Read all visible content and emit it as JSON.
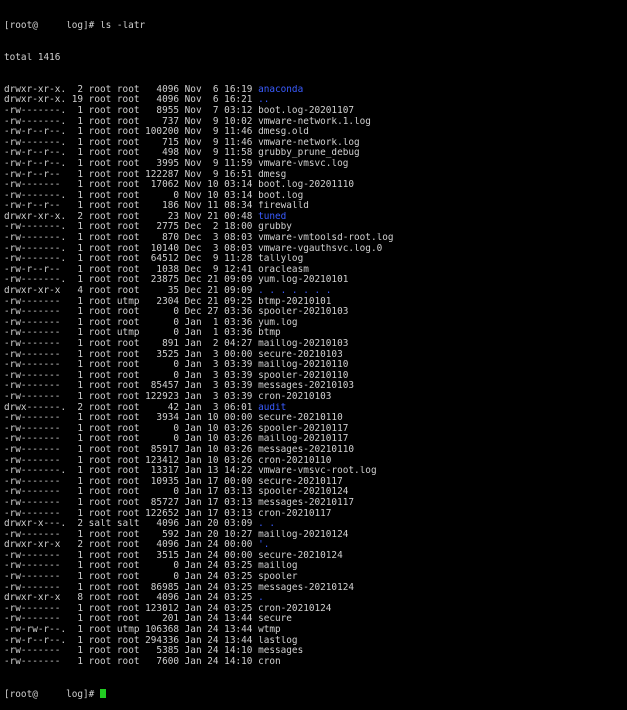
{
  "colors": {
    "background": "#000000",
    "text": "#d0d0d0",
    "directory": "#3a5cff",
    "cursor": "#22cc22"
  },
  "prompt": "[root@     log]# ls -latr",
  "total": "total 1416",
  "entries": [
    {
      "perm": "drwxr-xr-x.",
      "links": "2",
      "owner": "root",
      "group": "root",
      "size": "4096",
      "month": "Nov",
      "day": "6",
      "time": "16:19",
      "name": "anaconda",
      "is_dir": true
    },
    {
      "perm": "drwxr-xr-x.",
      "links": "19",
      "owner": "root",
      "group": "root",
      "size": "4096",
      "month": "Nov",
      "day": "6",
      "time": "16:21",
      "name": "..",
      "is_dir": true
    },
    {
      "perm": "-rw-------.",
      "links": "1",
      "owner": "root",
      "group": "root",
      "size": "8955",
      "month": "Nov",
      "day": "7",
      "time": "03:12",
      "name": "boot.log-20201107",
      "is_dir": false
    },
    {
      "perm": "-rw-------.",
      "links": "1",
      "owner": "root",
      "group": "root",
      "size": "737",
      "month": "Nov",
      "day": "9",
      "time": "10:02",
      "name": "vmware-network.1.log",
      "is_dir": false
    },
    {
      "perm": "-rw-r--r--.",
      "links": "1",
      "owner": "root",
      "group": "root",
      "size": "100200",
      "month": "Nov",
      "day": "9",
      "time": "11:46",
      "name": "dmesg.old",
      "is_dir": false
    },
    {
      "perm": "-rw-------.",
      "links": "1",
      "owner": "root",
      "group": "root",
      "size": "715",
      "month": "Nov",
      "day": "9",
      "time": "11:46",
      "name": "vmware-network.log",
      "is_dir": false
    },
    {
      "perm": "-rw-r--r--.",
      "links": "1",
      "owner": "root",
      "group": "root",
      "size": "498",
      "month": "Nov",
      "day": "9",
      "time": "11:58",
      "name": "grubby_prune_debug",
      "is_dir": false
    },
    {
      "perm": "-rw-r--r--.",
      "links": "1",
      "owner": "root",
      "group": "root",
      "size": "3995",
      "month": "Nov",
      "day": "9",
      "time": "11:59",
      "name": "vmware-vmsvc.log",
      "is_dir": false
    },
    {
      "perm": "-rw-r--r--",
      "links": "1",
      "owner": "root",
      "group": "root",
      "size": "122287",
      "month": "Nov",
      "day": "9",
      "time": "16:51",
      "name": "dmesg",
      "is_dir": false
    },
    {
      "perm": "-rw-------",
      "links": "1",
      "owner": "root",
      "group": "root",
      "size": "17062",
      "month": "Nov",
      "day": "10",
      "time": "03:14",
      "name": "boot.log-20201110",
      "is_dir": false
    },
    {
      "perm": "-rw-------.",
      "links": "1",
      "owner": "root",
      "group": "root",
      "size": "0",
      "month": "Nov",
      "day": "10",
      "time": "03:14",
      "name": "boot.log",
      "is_dir": false
    },
    {
      "perm": "-rw-r--r--",
      "links": "1",
      "owner": "root",
      "group": "root",
      "size": "186",
      "month": "Nov",
      "day": "11",
      "time": "08:34",
      "name": "firewalld",
      "is_dir": false
    },
    {
      "perm": "drwxr-xr-x.",
      "links": "2",
      "owner": "root",
      "group": "root",
      "size": "23",
      "month": "Nov",
      "day": "21",
      "time": "00:48",
      "name": "tuned",
      "is_dir": true
    },
    {
      "perm": "-rw-------.",
      "links": "1",
      "owner": "root",
      "group": "root",
      "size": "2775",
      "month": "Dec",
      "day": "2",
      "time": "18:00",
      "name": "grubby",
      "is_dir": false
    },
    {
      "perm": "-rw-------.",
      "links": "1",
      "owner": "root",
      "group": "root",
      "size": "870",
      "month": "Dec",
      "day": "3",
      "time": "08:03",
      "name": "vmware-vmtoolsd-root.log",
      "is_dir": false
    },
    {
      "perm": "-rw-------.",
      "links": "1",
      "owner": "root",
      "group": "root",
      "size": "10140",
      "month": "Dec",
      "day": "3",
      "time": "08:03",
      "name": "vmware-vgauthsvc.log.0",
      "is_dir": false
    },
    {
      "perm": "-rw-------.",
      "links": "1",
      "owner": "root",
      "group": "root",
      "size": "64512",
      "month": "Dec",
      "day": "9",
      "time": "11:28",
      "name": "tallylog",
      "is_dir": false
    },
    {
      "perm": "-rw-r--r--",
      "links": "1",
      "owner": "root",
      "group": "root",
      "size": "1038",
      "month": "Dec",
      "day": "9",
      "time": "12:41",
      "name": "oracleasm",
      "is_dir": false
    },
    {
      "perm": "-rw-------.",
      "links": "1",
      "owner": "root",
      "group": "root",
      "size": "23875",
      "month": "Dec",
      "day": "21",
      "time": "09:09",
      "name": "yum.log-20210101",
      "is_dir": false
    },
    {
      "perm": "drwxr-xr-x",
      "links": "4",
      "owner": "root",
      "group": "root",
      "size": "35",
      "month": "Dec",
      "day": "21",
      "time": "09:09",
      "name": ". . . . . . .",
      "is_dir": true
    },
    {
      "perm": "-rw-------",
      "links": "1",
      "owner": "root",
      "group": "utmp",
      "size": "2304",
      "month": "Dec",
      "day": "21",
      "time": "09:25",
      "name": "btmp-20210101",
      "is_dir": false
    },
    {
      "perm": "-rw-------",
      "links": "1",
      "owner": "root",
      "group": "root",
      "size": "0",
      "month": "Dec",
      "day": "27",
      "time": "03:36",
      "name": "spooler-20210103",
      "is_dir": false
    },
    {
      "perm": "-rw-------",
      "links": "1",
      "owner": "root",
      "group": "root",
      "size": "0",
      "month": "Jan",
      "day": "1",
      "time": "03:36",
      "name": "yum.log",
      "is_dir": false
    },
    {
      "perm": "-rw-------",
      "links": "1",
      "owner": "root",
      "group": "utmp",
      "size": "0",
      "month": "Jan",
      "day": "1",
      "time": "03:36",
      "name": "btmp",
      "is_dir": false
    },
    {
      "perm": "-rw-------",
      "links": "1",
      "owner": "root",
      "group": "root",
      "size": "891",
      "month": "Jan",
      "day": "2",
      "time": "04:27",
      "name": "maillog-20210103",
      "is_dir": false
    },
    {
      "perm": "-rw-------",
      "links": "1",
      "owner": "root",
      "group": "root",
      "size": "3525",
      "month": "Jan",
      "day": "3",
      "time": "00:00",
      "name": "secure-20210103",
      "is_dir": false
    },
    {
      "perm": "-rw-------",
      "links": "1",
      "owner": "root",
      "group": "root",
      "size": "0",
      "month": "Jan",
      "day": "3",
      "time": "03:39",
      "name": "maillog-20210110",
      "is_dir": false
    },
    {
      "perm": "-rw-------",
      "links": "1",
      "owner": "root",
      "group": "root",
      "size": "0",
      "month": "Jan",
      "day": "3",
      "time": "03:39",
      "name": "spooler-20210110",
      "is_dir": false
    },
    {
      "perm": "-rw-------",
      "links": "1",
      "owner": "root",
      "group": "root",
      "size": "85457",
      "month": "Jan",
      "day": "3",
      "time": "03:39",
      "name": "messages-20210103",
      "is_dir": false
    },
    {
      "perm": "-rw-------",
      "links": "1",
      "owner": "root",
      "group": "root",
      "size": "122923",
      "month": "Jan",
      "day": "3",
      "time": "03:39",
      "name": "cron-20210103",
      "is_dir": false
    },
    {
      "perm": "drwx------.",
      "links": "2",
      "owner": "root",
      "group": "root",
      "size": "42",
      "month": "Jan",
      "day": "3",
      "time": "06:01",
      "name": "audit",
      "is_dir": true
    },
    {
      "perm": "-rw-------",
      "links": "1",
      "owner": "root",
      "group": "root",
      "size": "3934",
      "month": "Jan",
      "day": "10",
      "time": "00:00",
      "name": "secure-20210110",
      "is_dir": false
    },
    {
      "perm": "-rw-------",
      "links": "1",
      "owner": "root",
      "group": "root",
      "size": "0",
      "month": "Jan",
      "day": "10",
      "time": "03:26",
      "name": "spooler-20210117",
      "is_dir": false
    },
    {
      "perm": "-rw-------",
      "links": "1",
      "owner": "root",
      "group": "root",
      "size": "0",
      "month": "Jan",
      "day": "10",
      "time": "03:26",
      "name": "maillog-20210117",
      "is_dir": false
    },
    {
      "perm": "-rw-------",
      "links": "1",
      "owner": "root",
      "group": "root",
      "size": "85917",
      "month": "Jan",
      "day": "10",
      "time": "03:26",
      "name": "messages-20210110",
      "is_dir": false
    },
    {
      "perm": "-rw-------",
      "links": "1",
      "owner": "root",
      "group": "root",
      "size": "123412",
      "month": "Jan",
      "day": "10",
      "time": "03:26",
      "name": "cron-20210110",
      "is_dir": false
    },
    {
      "perm": "-rw-------.",
      "links": "1",
      "owner": "root",
      "group": "root",
      "size": "13317",
      "month": "Jan",
      "day": "13",
      "time": "14:22",
      "name": "vmware-vmsvc-root.log",
      "is_dir": false
    },
    {
      "perm": "-rw-------",
      "links": "1",
      "owner": "root",
      "group": "root",
      "size": "10935",
      "month": "Jan",
      "day": "17",
      "time": "00:00",
      "name": "secure-20210117",
      "is_dir": false
    },
    {
      "perm": "-rw-------",
      "links": "1",
      "owner": "root",
      "group": "root",
      "size": "0",
      "month": "Jan",
      "day": "17",
      "time": "03:13",
      "name": "spooler-20210124",
      "is_dir": false
    },
    {
      "perm": "-rw-------",
      "links": "1",
      "owner": "root",
      "group": "root",
      "size": "85727",
      "month": "Jan",
      "day": "17",
      "time": "03:13",
      "name": "messages-20210117",
      "is_dir": false
    },
    {
      "perm": "-rw-------",
      "links": "1",
      "owner": "root",
      "group": "root",
      "size": "122652",
      "month": "Jan",
      "day": "17",
      "time": "03:13",
      "name": "cron-20210117",
      "is_dir": false
    },
    {
      "perm": "drwxr-x---.",
      "links": "2",
      "owner": "salt",
      "group": "salt",
      "size": "4096",
      "month": "Jan",
      "day": "20",
      "time": "03:09",
      "name": ". .",
      "is_dir": true
    },
    {
      "perm": "-rw-------",
      "links": "1",
      "owner": "root",
      "group": "root",
      "size": "592",
      "month": "Jan",
      "day": "20",
      "time": "10:27",
      "name": "maillog-20210124",
      "is_dir": false
    },
    {
      "perm": "drwxr-xr-x",
      "links": "2",
      "owner": "root",
      "group": "root",
      "size": "4096",
      "month": "Jan",
      "day": "24",
      "time": "00:00",
      "name": "'.",
      "is_dir": true
    },
    {
      "perm": "-rw-------",
      "links": "1",
      "owner": "root",
      "group": "root",
      "size": "3515",
      "month": "Jan",
      "day": "24",
      "time": "00:00",
      "name": "secure-20210124",
      "is_dir": false
    },
    {
      "perm": "-rw-------",
      "links": "1",
      "owner": "root",
      "group": "root",
      "size": "0",
      "month": "Jan",
      "day": "24",
      "time": "03:25",
      "name": "maillog",
      "is_dir": false
    },
    {
      "perm": "-rw-------",
      "links": "1",
      "owner": "root",
      "group": "root",
      "size": "0",
      "month": "Jan",
      "day": "24",
      "time": "03:25",
      "name": "spooler",
      "is_dir": false
    },
    {
      "perm": "-rw-------",
      "links": "1",
      "owner": "root",
      "group": "root",
      "size": "86985",
      "month": "Jan",
      "day": "24",
      "time": "03:25",
      "name": "messages-20210124",
      "is_dir": false
    },
    {
      "perm": "drwxr-xr-x",
      "links": "8",
      "owner": "root",
      "group": "root",
      "size": "4096",
      "month": "Jan",
      "day": "24",
      "time": "03:25",
      "name": ".",
      "is_dir": true
    },
    {
      "perm": "-rw-------",
      "links": "1",
      "owner": "root",
      "group": "root",
      "size": "123012",
      "month": "Jan",
      "day": "24",
      "time": "03:25",
      "name": "cron-20210124",
      "is_dir": false
    },
    {
      "perm": "-rw-------",
      "links": "1",
      "owner": "root",
      "group": "root",
      "size": "201",
      "month": "Jan",
      "day": "24",
      "time": "13:44",
      "name": "secure",
      "is_dir": false
    },
    {
      "perm": "-rw-rw-r--.",
      "links": "1",
      "owner": "root",
      "group": "utmp",
      "size": "106368",
      "month": "Jan",
      "day": "24",
      "time": "13:44",
      "name": "wtmp",
      "is_dir": false
    },
    {
      "perm": "-rw-r--r--.",
      "links": "1",
      "owner": "root",
      "group": "root",
      "size": "294336",
      "month": "Jan",
      "day": "24",
      "time": "13:44",
      "name": "lastlog",
      "is_dir": false
    },
    {
      "perm": "-rw-------",
      "links": "1",
      "owner": "root",
      "group": "root",
      "size": "5385",
      "month": "Jan",
      "day": "24",
      "time": "14:10",
      "name": "messages",
      "is_dir": false
    },
    {
      "perm": "-rw-------",
      "links": "1",
      "owner": "root",
      "group": "root",
      "size": "7600",
      "month": "Jan",
      "day": "24",
      "time": "14:10",
      "name": "cron",
      "is_dir": false
    }
  ],
  "final_prompt": "[root@     log]# "
}
